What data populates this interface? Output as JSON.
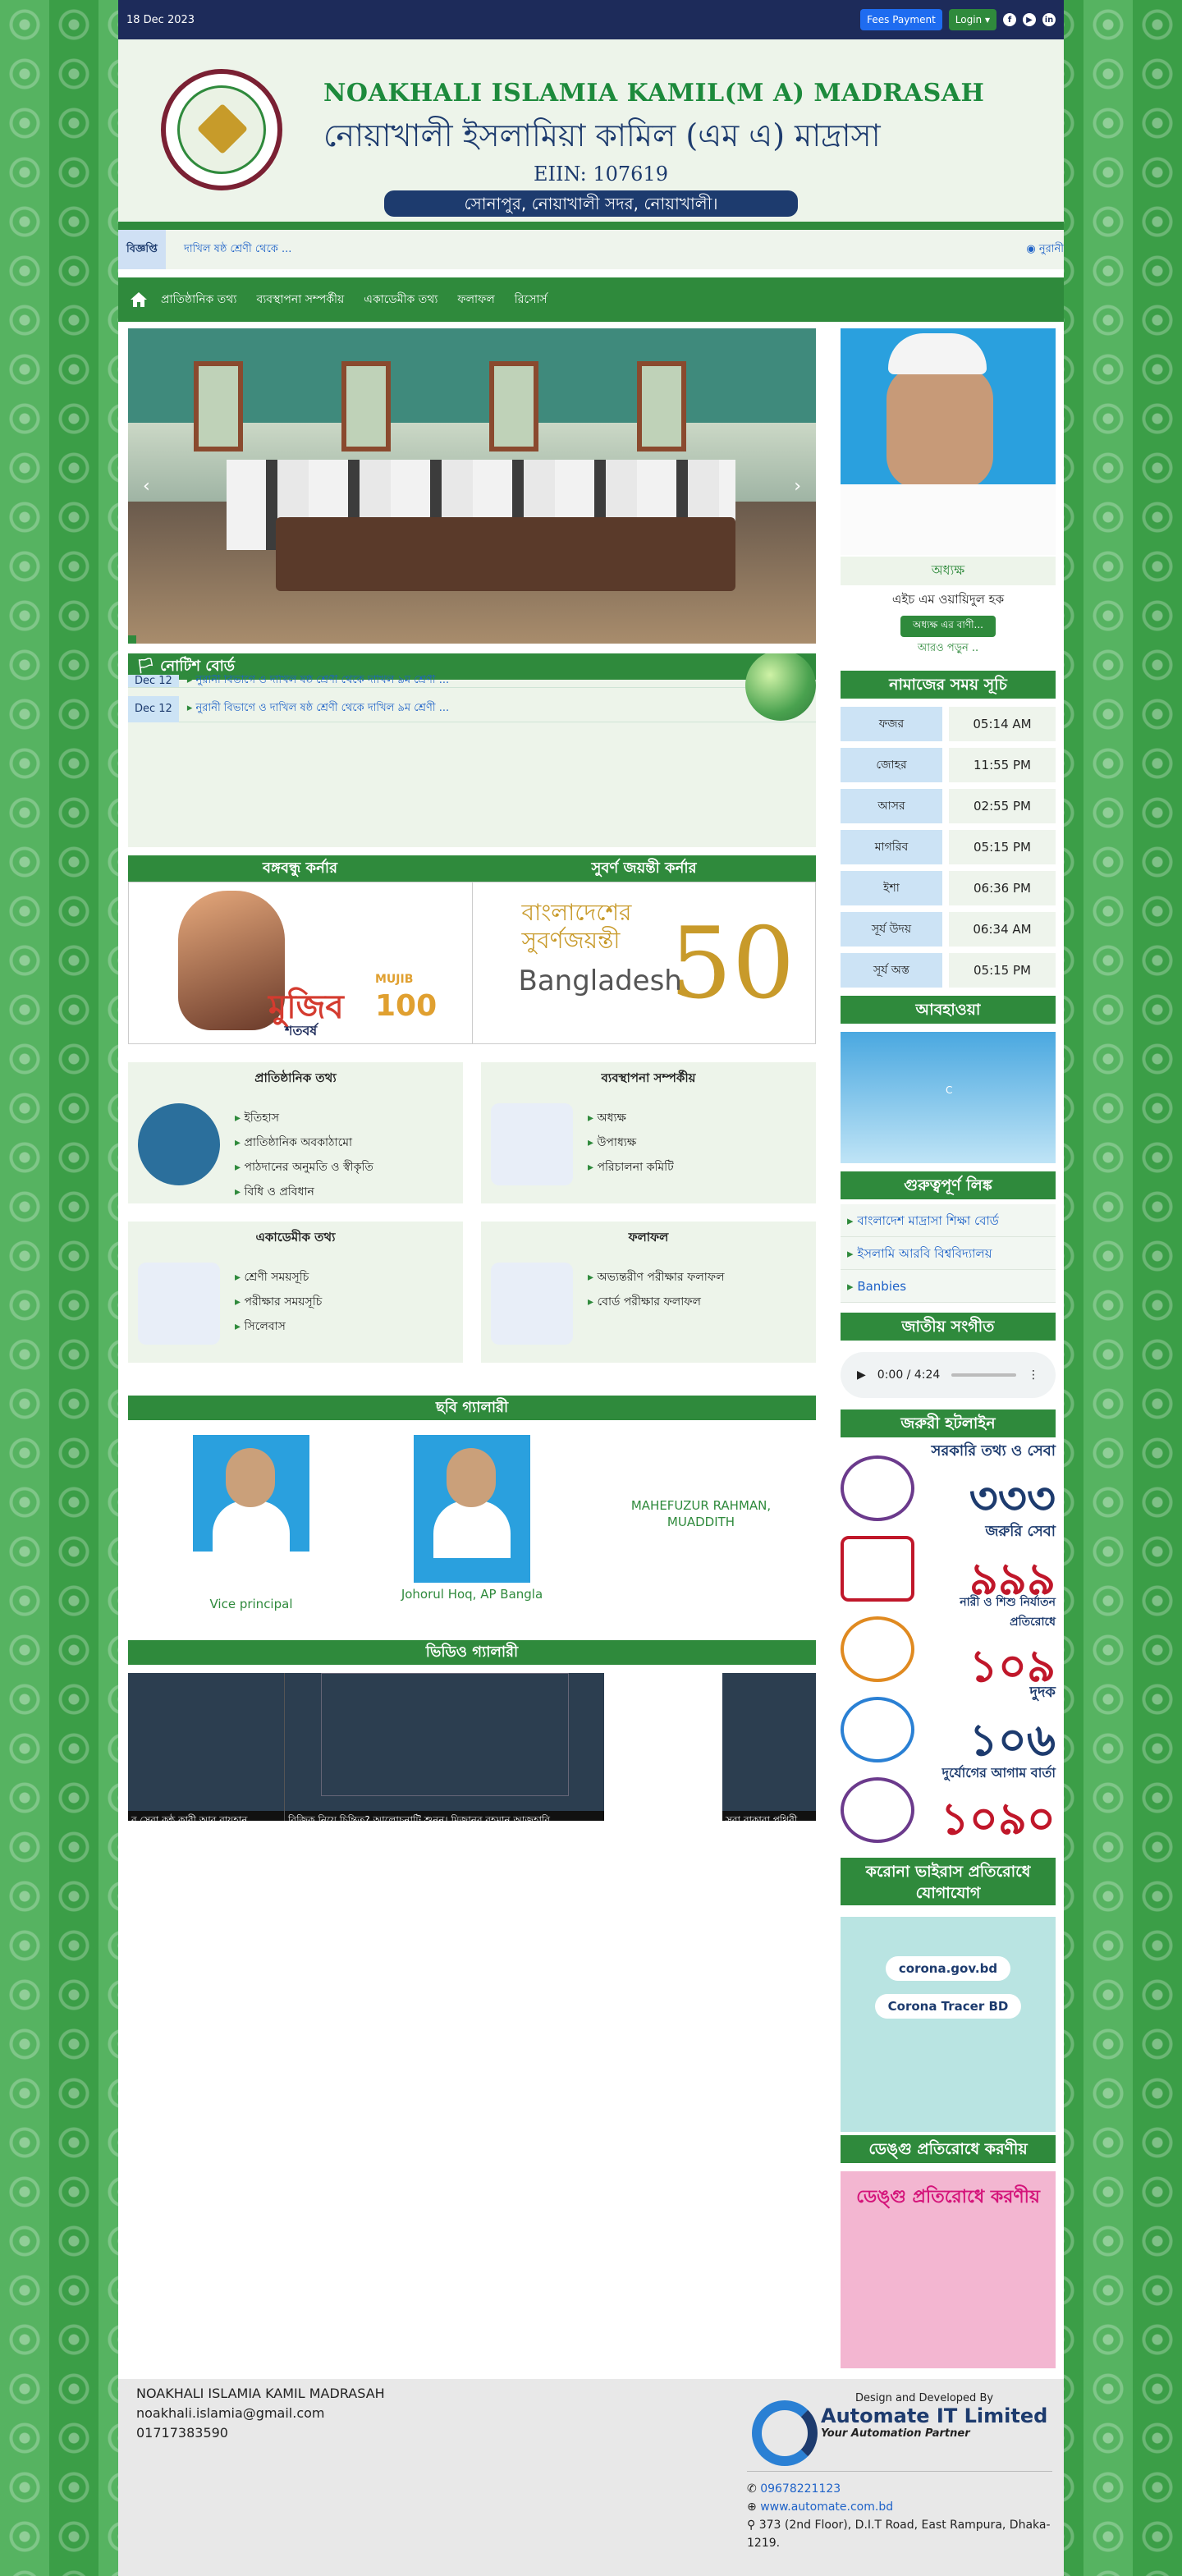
{
  "topbar": {
    "date": "18 Dec 2023",
    "fees": "Fees Payment",
    "login": "Login",
    "facebook": "f",
    "youtube": "▶",
    "linkedin": "in"
  },
  "header": {
    "name_en": "NOAKHALI ISLAMIA KAMIL(M A) MADRASAH",
    "name_bn": "নোয়াখালী ইসলামিয়া কামিল (এম এ) মাদ্রাসা",
    "eiin": "EIIN: 107619",
    "address": "সোনাপুর, নোয়াখালী সদর, নোয়াখালী।"
  },
  "notice_bar": {
    "label": "বিজ্ঞপ্তি",
    "scroll_left": "দাখিল ষষ্ঠ শ্রেণী থেকে ...",
    "scroll_right": "নুরানী"
  },
  "nav": {
    "items": [
      "প্রাতিষ্ঠানিক তথ্য",
      "ব্যবস্থাপনা সম্পর্কীয়",
      "একাডেমীক তথ্য",
      "ফলাফল",
      "রিসোর্স"
    ]
  },
  "notice_board": {
    "title": "নোটিশ বোর্ড",
    "rows": [
      {
        "date": "Dec 12",
        "text": "নুরানী বিভাগে ও দাখিল ষষ্ঠ শ্রেণী থেকে দাখিল ৯ম শ্রেণী ..."
      },
      {
        "date": "Dec 12",
        "text": "নুরানী বিভাগে ও দাখিল ষষ্ঠ শ্রেণী থেকে দাখিল ৯ম শ্রেণী ..."
      }
    ]
  },
  "corners": {
    "left": "বঙ্গবন্ধু কর্নার",
    "right": "সুবর্ণ জয়ন্তী কর্নার",
    "mujib_bn": "মুজিব",
    "mujib_sub": "শতবর্ষ",
    "mujib_en": "MUJIB",
    "mujib_num": "100",
    "jayanti_bn": "বাংলাদেশের সুবর্ণজয়ন্তী",
    "jayanti_en": "Bangladesh",
    "jayanti_num": "50"
  },
  "cards": [
    {
      "title": "প্রাতিষ্ঠানিক তথ্য",
      "items": [
        "ইতিহাস",
        "প্রাতিষ্ঠানিক অবকাঠামো",
        "পাঠদানের অনুমতি ও স্বীকৃতি",
        "বিধি ও প্রবিধান"
      ]
    },
    {
      "title": "ব্যবস্থাপনা সম্পর্কীয়",
      "items": [
        "অধ্যক্ষ",
        "উপাধ্যক্ষ",
        "পরিচালনা কমিটি"
      ]
    },
    {
      "title": "একাডেমীক তথ্য",
      "items": [
        "শ্রেণী সময়সূচি",
        "পরীক্ষার সময়সূচি",
        "সিলেবাস"
      ]
    },
    {
      "title": "ফলাফল",
      "items": [
        "অভ্যন্তরীণ পরীক্ষার ফলাফল",
        "বোর্ড পরীক্ষার ফলাফল"
      ]
    }
  ],
  "gallery": {
    "title": "ছবি গ্যালারী",
    "items": [
      "Vice principal",
      "Johorul Hoq, AP Bangla",
      "MAHEFUZUR RAHMAN, MUADDITH"
    ]
  },
  "video": {
    "title": "ভিডিও গ্যালারী",
    "captions": [
      "র সেরা কন্ঠ কারী আবু রায়হান",
      "বিজিক নিয়ে চিন্তিত? আলোচনাটি শুনুন। মিজানুর রহমান আজহারি",
      "সূরা বাকারা পৃথিবী"
    ]
  },
  "principal": {
    "title": "অধ্যক্ষ",
    "name": "এইচ এম ওয়ায়িদুল হক",
    "button": "অধ্যক্ষ এর বাণী...",
    "more": "আরও পড়ুন .."
  },
  "prayer": {
    "title": "নামাজের সময় সূচি",
    "rows": [
      {
        "k": "ফজর",
        "v": "05:14 AM"
      },
      {
        "k": "জোহর",
        "v": "11:55 PM"
      },
      {
        "k": "আসর",
        "v": "02:55 PM"
      },
      {
        "k": "মাগরিব",
        "v": "05:15 PM"
      },
      {
        "k": "ইশা",
        "v": "06:36 PM"
      },
      {
        "k": "সূর্য উদয়",
        "v": "06:34 AM"
      },
      {
        "k": "সূর্য অস্ত",
        "v": "05:15 PM"
      }
    ]
  },
  "weather": {
    "title": "আবহাওয়া",
    "temp": "C"
  },
  "links": {
    "title": "গুরুত্বপূর্ণ লিঙ্ক",
    "items": [
      "বাংলাদেশ মাদ্রাসা শিক্ষা বোর্ড",
      "ইসলামি আরবি বিশ্ববিদ্যালয়",
      "Banbies"
    ]
  },
  "anthem": {
    "title": "জাতীয় সংগীত",
    "time": "0:00 / 4:24"
  },
  "helpline": {
    "title": "জরুরী হটলাইন",
    "rows": [
      {
        "label": "সরকারি তথ্য ও সেবা",
        "num": "৩৩৩"
      },
      {
        "label": "জরুরি সেবা",
        "num": "৯৯৯"
      },
      {
        "label": "নারী ও শিশু নির্যাতন প্রতিরোধে",
        "num": "১০৯"
      },
      {
        "label": "দুদক",
        "num": "১০৬"
      },
      {
        "label": "দুর্যোগের আগাম বার্তা",
        "num": "১০৯০"
      }
    ]
  },
  "corona": {
    "title": "করোনা ভাইরাস প্রতিরোধে যোগাযোগ",
    "site": "corona.gov.bd",
    "app": "Corona Tracer BD"
  },
  "dengue": {
    "title": "ডেঙ্গু প্রতিরোধে করণীয়",
    "banner": "ডেঙ্গু প্রতিরোধে করণীয়"
  },
  "footer": {
    "name": "NOAKHALI ISLAMIA KAMIL MADRASAH",
    "email": "noakhali.islamia@gmail.com",
    "phone": "01717383590",
    "designed": "Design and Developed By",
    "company": "Automate IT Limited",
    "tagline": "Your Automation Partner",
    "dev_phone": "09678221123",
    "dev_web": "www.automate.com.bd",
    "dev_addr": "373 (2nd Floor), D.I.T Road, East Rampura, Dhaka-1219."
  }
}
